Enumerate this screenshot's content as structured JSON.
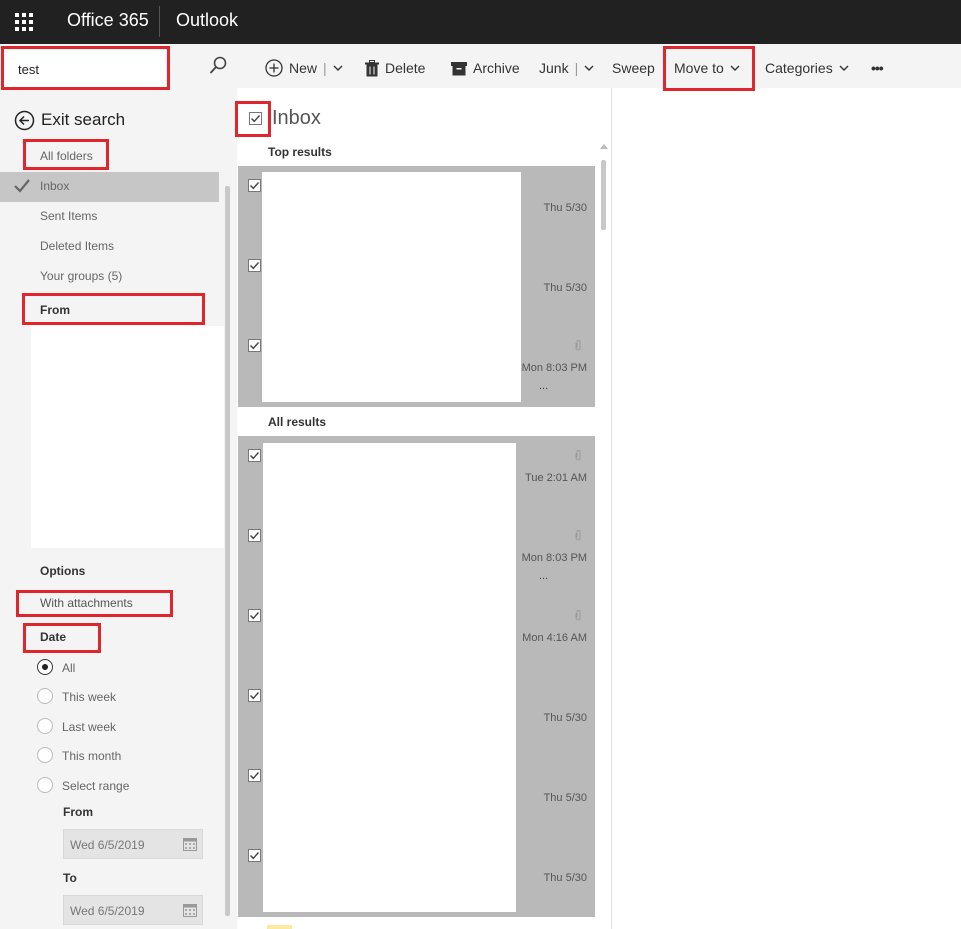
{
  "topbar": {
    "app_suite": "Office 365",
    "app_name": "Outlook",
    "background": "#212121"
  },
  "search": {
    "value": "test"
  },
  "left": {
    "exit_search": "Exit search",
    "folders": [
      "All folders",
      "Inbox",
      "Sent Items",
      "Deleted Items",
      "Your groups (5)"
    ],
    "selected_folder": "Inbox",
    "from_header": "From",
    "options_header": "Options",
    "with_attachments": "With attachments",
    "date_header": "Date",
    "date_options": [
      "All",
      "This week",
      "Last week",
      "This month",
      "Select range"
    ],
    "selected_date_option": "All",
    "range_from_label": "From",
    "range_from_value": "Wed 6/5/2019",
    "range_to_label": "To",
    "range_to_value": "Wed 6/5/2019"
  },
  "toolbar": {
    "new": "New",
    "delete": "Delete",
    "archive": "Archive",
    "junk": "Junk",
    "sweep": "Sweep",
    "move_to": "Move to",
    "categories": "Categories",
    "more": "•••"
  },
  "list": {
    "title": "Inbox",
    "top_results_label": "Top results",
    "all_results_label": "All results",
    "top_results_dates": [
      "Thu 5/30",
      "Thu 5/30",
      "Mon 8:03 PM"
    ],
    "all_results_dates": [
      "Tue 2:01 AM",
      "Mon 8:03 PM",
      "Mon 4:16 AM",
      "Thu 5/30",
      "Thu 5/30",
      "Thu 5/30"
    ],
    "ellipsis": "..."
  },
  "colors": {
    "highlight_box": "#e0262d",
    "selected_row": "#b9b9b9",
    "pane_bg": "#f4f4f4"
  }
}
